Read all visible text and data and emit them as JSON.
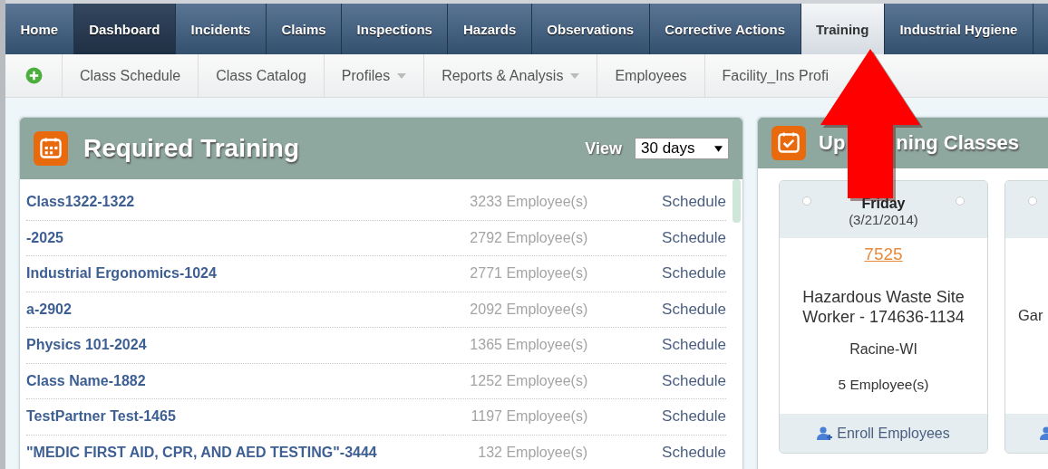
{
  "top_nav": [
    {
      "label": "Home",
      "selected": false,
      "highlighted": false
    },
    {
      "label": "Dashboard",
      "selected": false,
      "highlighted": true
    },
    {
      "label": "Incidents",
      "selected": false,
      "highlighted": false
    },
    {
      "label": "Claims",
      "selected": false,
      "highlighted": false
    },
    {
      "label": "Inspections",
      "selected": false,
      "highlighted": false
    },
    {
      "label": "Hazards",
      "selected": false,
      "highlighted": false
    },
    {
      "label": "Observations",
      "selected": false,
      "highlighted": false
    },
    {
      "label": "Corrective Actions",
      "selected": false,
      "highlighted": false
    },
    {
      "label": "Training",
      "selected": true,
      "highlighted": false
    },
    {
      "label": "Industrial Hygiene",
      "selected": false,
      "highlighted": false
    }
  ],
  "sub_nav": [
    {
      "label": "Class Schedule",
      "has_menu": false
    },
    {
      "label": "Class Catalog",
      "has_menu": false
    },
    {
      "label": "Profiles",
      "has_menu": true
    },
    {
      "label": "Reports & Analysis",
      "has_menu": true
    },
    {
      "label": "Employees",
      "has_menu": false
    },
    {
      "label": "Facility_Ins Profi",
      "has_menu": false
    }
  ],
  "required_training": {
    "title": "Required Training",
    "view_label": "View",
    "view_value": "30 days",
    "rows": [
      {
        "name": "Class1322-1322",
        "count": "3233 Employee(s)",
        "action": "Schedule"
      },
      {
        "name": "-2025",
        "count": "2792 Employee(s)",
        "action": "Schedule"
      },
      {
        "name": "Industrial Ergonomics-1024",
        "count": "2771 Employee(s)",
        "action": "Schedule"
      },
      {
        "name": "a-2902",
        "count": "2092 Employee(s)",
        "action": "Schedule"
      },
      {
        "name": "Physics 101-2024",
        "count": "1365 Employee(s)",
        "action": "Schedule"
      },
      {
        "name": "Class Name-1882",
        "count": "1252 Employee(s)",
        "action": "Schedule"
      },
      {
        "name": "TestPartner Test-1465",
        "count": "1197 Employee(s)",
        "action": "Schedule"
      },
      {
        "name": "\"MEDIC FIRST AID, CPR, AND AED TESTING\"-3444",
        "count": "132 Employee(s)",
        "action": "Schedule"
      }
    ]
  },
  "upcoming_classes": {
    "title_start": "Up",
    "title_end": "ning Classes",
    "cards": [
      {
        "day": "Friday",
        "date": "(3/21/2014)",
        "code": "7525",
        "description": "Hazardous Waste Site Worker - 174636-1134",
        "location": "Racine-WI",
        "count": "5 Employee(s)",
        "enroll": "Enroll Employees"
      },
      {
        "description": "Gar"
      }
    ]
  }
}
